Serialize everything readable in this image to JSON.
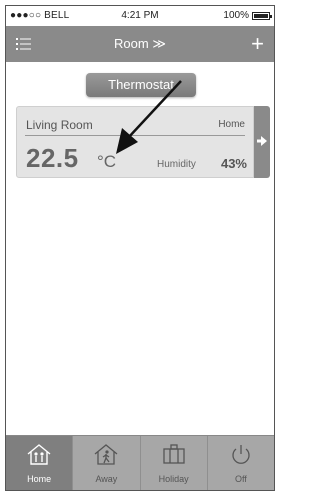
{
  "status_bar": {
    "carrier": "●●●○○ BELL",
    "time": "4:21 PM",
    "battery": "100%"
  },
  "navbar": {
    "title": "Room ≫"
  },
  "thermostat_button": "Thermostat",
  "room_card": {
    "name": "Living Room",
    "mode": "Home",
    "temperature": "22.5",
    "unit": "°C",
    "humidity_label": "Humidity",
    "humidity_value": "43%"
  },
  "tabs": [
    {
      "label": "Home",
      "icon": "home-icon",
      "active": true
    },
    {
      "label": "Away",
      "icon": "away-icon",
      "active": false
    },
    {
      "label": "Holiday",
      "icon": "luggage-icon",
      "active": false
    },
    {
      "label": "Off",
      "icon": "power-icon",
      "active": false
    }
  ],
  "colors": {
    "navbar": "#8a8a8a",
    "card": "#e4e4e4",
    "tabbar_active": "#7f7f7f",
    "tabbar": "#a7a7a7"
  }
}
